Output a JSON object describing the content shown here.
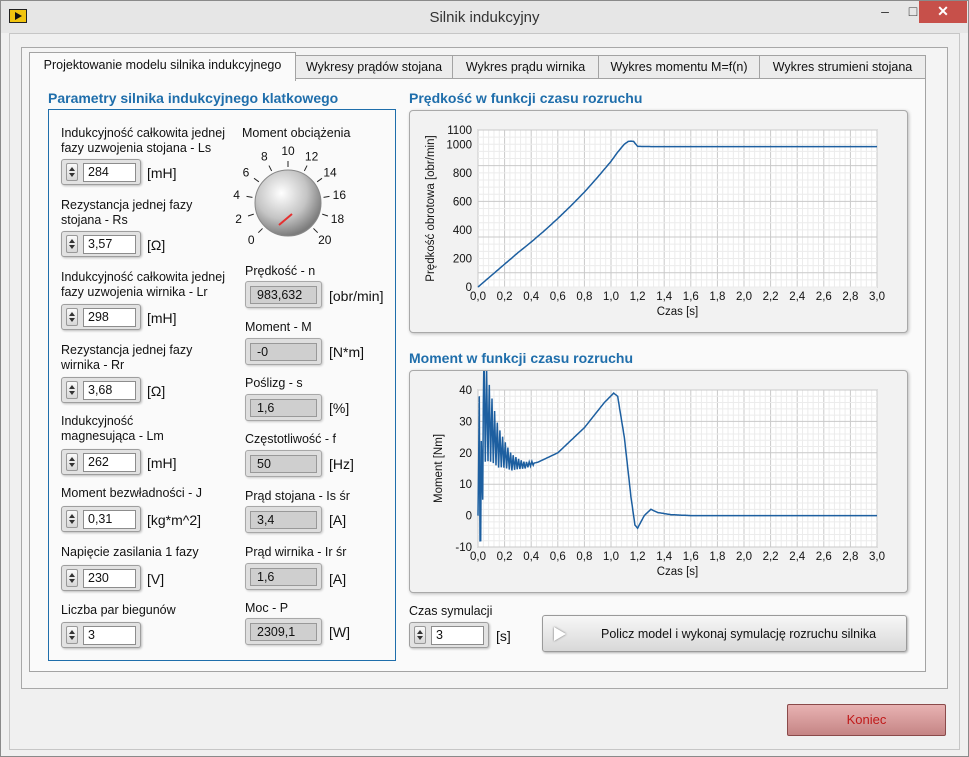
{
  "window": {
    "title": "Silnik indukcyjny",
    "min": "–",
    "max": "□",
    "close": "✕"
  },
  "tabs": [
    "Projektowanie modelu silnika indukcyjnego",
    "Wykresy prądów stojana",
    "Wykres prądu wirnika",
    "Wykres momentu M=f(n)",
    "Wykres strumieni stojana"
  ],
  "params": {
    "title": "Parametry silnika indukcyjnego klatkowego",
    "items": [
      {
        "label": "Indukcyjność całkowita jednej fazy uzwojenia stojana - Ls",
        "value": "284",
        "unit": "[mH]"
      },
      {
        "label": "Rezystancja jednej fazy stojana - Rs",
        "value": "3,57",
        "unit": "[Ω]"
      },
      {
        "label": "Indukcyjność całkowita jednej fazy uzwojenia wirnika - Lr",
        "value": "298",
        "unit": "[mH]"
      },
      {
        "label": "Rezystancja jednej fazy  wirnika - Rr",
        "value": "3,68",
        "unit": "[Ω]"
      },
      {
        "label": "Indukcyjność magnesująca - Lm",
        "value": "262",
        "unit": "[mH]"
      },
      {
        "label": "Moment bezwładności - J",
        "value": "0,31",
        "unit": "[kg*m^2]"
      },
      {
        "label": "Napięcie zasilania 1 fazy",
        "value": "230",
        "unit": "[V]"
      },
      {
        "label": "Liczba par biegunów",
        "value": "3",
        "unit": ""
      }
    ]
  },
  "load": {
    "label": "Moment obciążenia",
    "ticks": [
      "0",
      "2",
      "4",
      "6",
      "8",
      "10",
      "12",
      "14",
      "16",
      "18",
      "20"
    ],
    "value": 0
  },
  "indicators": [
    {
      "label": "Prędkość - n",
      "value": "983,632",
      "unit": "[obr/min]"
    },
    {
      "label": "Moment - M",
      "value": "-0",
      "unit": "[N*m]"
    },
    {
      "label": "Poślizg - s",
      "value": "1,6",
      "unit": "[%]"
    },
    {
      "label": "Częstotliwość - f",
      "value": "50",
      "unit": "[Hz]"
    },
    {
      "label": "Prąd stojana - Is śr",
      "value": "3,4",
      "unit": "[A]"
    },
    {
      "label": "Prąd wirnika - Ir śr",
      "value": "1,6",
      "unit": "[A]"
    },
    {
      "label": "Moc - P",
      "value": "2309,1",
      "unit": "[W]"
    }
  ],
  "speed_chart": {
    "title": "Prędkość w funkcji czasu rozruchu",
    "ylabel": "Prędkość obrotowa [obr/min]",
    "xlabel": "Czas [s]",
    "yticks": [
      "0",
      "200",
      "400",
      "600",
      "800",
      "1000",
      "1100"
    ],
    "xticks": [
      "0,0",
      "0,2",
      "0,4",
      "0,6",
      "0,8",
      "1,0",
      "1,2",
      "1,4",
      "1,6",
      "1,8",
      "2,0",
      "2,2",
      "2,4",
      "2,6",
      "2,8",
      "3,0"
    ]
  },
  "torque_chart": {
    "title": "Moment w funkcji czasu rozruchu",
    "ylabel": "Moment [Nm]",
    "xlabel": "Czas [s]",
    "yticks": [
      "-10",
      "0",
      "10",
      "20",
      "30",
      "40"
    ],
    "xticks": [
      "0,0",
      "0,2",
      "0,4",
      "0,6",
      "0,8",
      "1,0",
      "1,2",
      "1,4",
      "1,6",
      "1,8",
      "2,0",
      "2,2",
      "2,4",
      "2,6",
      "2,8",
      "3,0"
    ]
  },
  "chart_data": [
    {
      "type": "line",
      "title": "Prędkość w funkcji czasu rozruchu",
      "xlabel": "Czas [s]",
      "ylabel": "Prędkość obrotowa [obr/min]",
      "xlim": [
        0,
        3
      ],
      "ylim": [
        0,
        1100
      ],
      "grid": true,
      "series": [
        {
          "x": [
            0,
            0.1,
            0.2,
            0.3,
            0.4,
            0.5,
            0.6,
            0.7,
            0.8,
            0.9,
            1.0,
            1.05,
            1.1,
            1.13,
            1.15,
            1.17,
            1.2,
            1.3,
            1.6,
            2.0,
            2.5,
            3.0
          ],
          "y": [
            0,
            80,
            160,
            240,
            315,
            395,
            480,
            570,
            665,
            770,
            880,
            945,
            1000,
            1020,
            1022,
            1020,
            985,
            984,
            984,
            984,
            984,
            984
          ]
        }
      ]
    },
    {
      "type": "line",
      "title": "Moment w funkcji czasu rozruchu",
      "xlabel": "Czas [s]",
      "ylabel": "Moment [Nm]",
      "xlim": [
        0,
        3
      ],
      "ylim": [
        -10,
        40
      ],
      "grid": true,
      "series": [
        {
          "x": [
            0,
            0.01,
            0.02,
            0.04,
            0.08,
            0.15,
            0.25,
            0.35,
            0.45,
            0.6,
            0.8,
            0.95,
            1.02,
            1.05,
            1.1,
            1.15,
            1.18,
            1.2,
            1.25,
            1.3,
            1.35,
            1.45,
            1.6,
            2.0,
            3.0
          ],
          "y": [
            0,
            38,
            -8,
            35,
            30,
            22,
            17,
            16,
            17,
            20,
            28,
            36,
            39,
            38,
            25,
            6,
            -3,
            -4,
            0,
            2,
            1,
            0.3,
            0,
            0,
            0
          ]
        }
      ]
    }
  ],
  "sim": {
    "label": "Czas symulacji",
    "value": "3",
    "unit": "[s]"
  },
  "run_button": "Policz model i wykonaj symulację  rozruchu silnika",
  "end_button": "Koniec"
}
